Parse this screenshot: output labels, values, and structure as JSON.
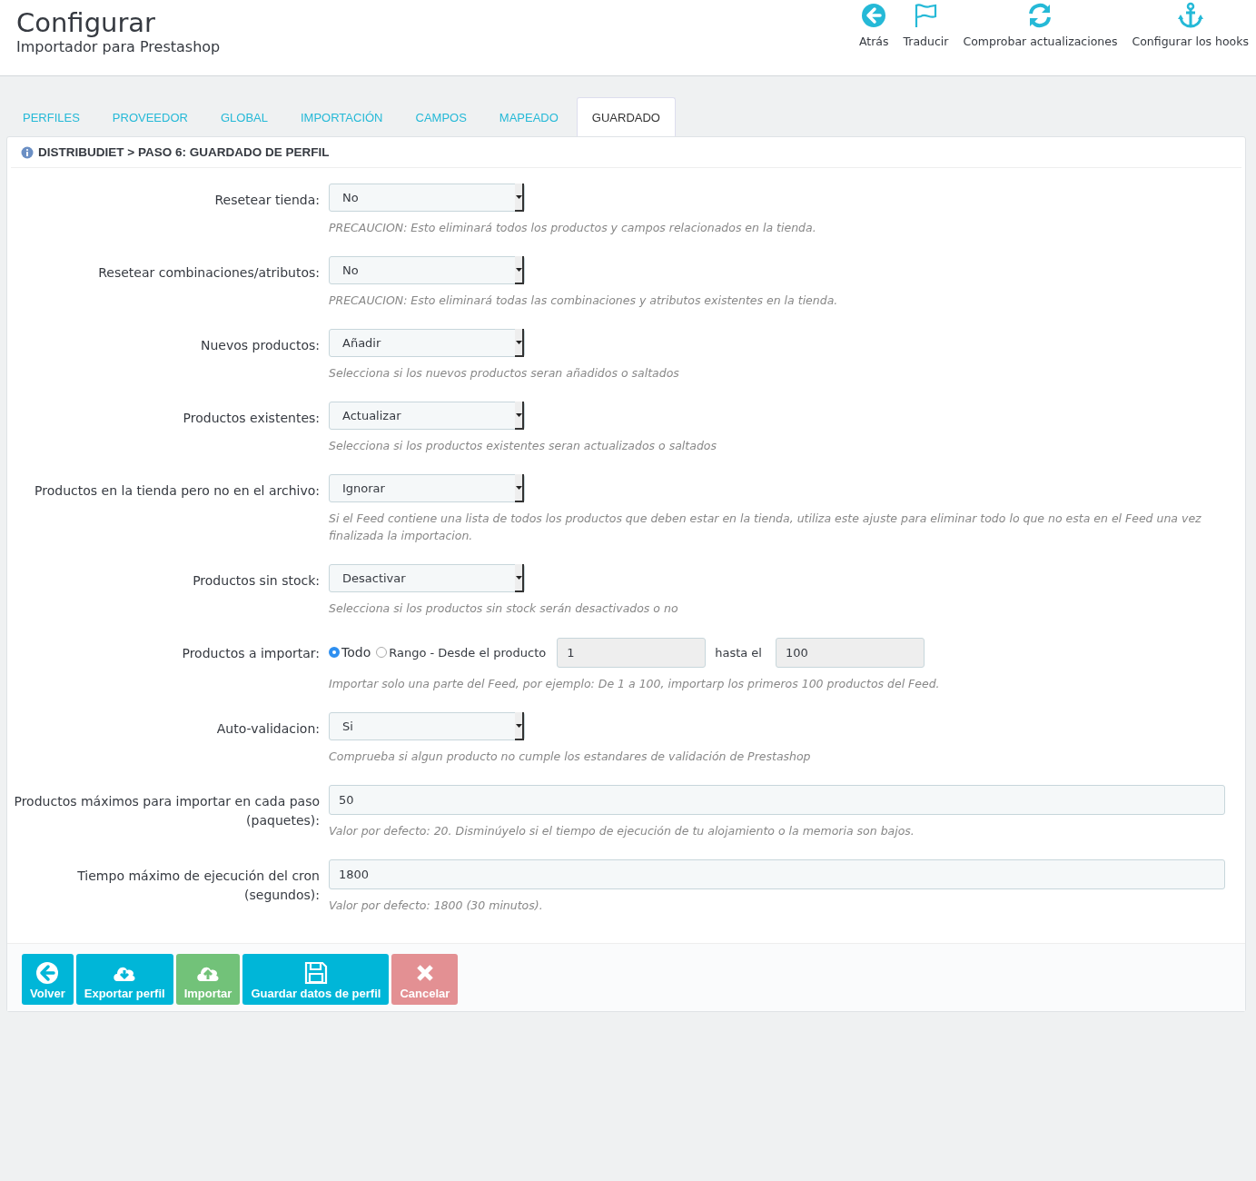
{
  "header": {
    "title": "Configurar",
    "subtitle": "Importador para Prestashop"
  },
  "toolbar": [
    {
      "kind": "back",
      "label": "Atrás"
    },
    {
      "kind": "flag",
      "label": "Traducir"
    },
    {
      "kind": "refresh",
      "label": "Comprobar actualizaciones"
    },
    {
      "kind": "anchor",
      "label": "Configurar los hooks"
    }
  ],
  "tabs": [
    {
      "label": "PERFILES",
      "selected": false
    },
    {
      "label": "PROVEEDOR",
      "selected": false
    },
    {
      "label": "GLOBAL",
      "selected": false
    },
    {
      "label": "IMPORTACIÓN",
      "selected": false
    },
    {
      "label": "CAMPOS",
      "selected": false
    },
    {
      "label": "MAPEADO",
      "selected": false
    },
    {
      "label": "GUARDADO",
      "selected": true
    }
  ],
  "panel": {
    "heading": "DISTRIBUDIET > PASO 6: GUARDADO DE PERFIL",
    "fields": [
      {
        "kind": "select",
        "label": "Resetear tienda:",
        "value": "No",
        "help": "PRECAUCION: Esto eliminará todos los productos y campos relacionados en la tienda."
      },
      {
        "kind": "select",
        "label": "Resetear combinaciones/atributos:",
        "value": "No",
        "help": "PRECAUCION: Esto eliminará todas las combinaciones y atributos existentes en la tienda."
      },
      {
        "kind": "select",
        "label": "Nuevos productos:",
        "value": "Añadir",
        "help": "Selecciona si los nuevos productos seran añadidos o saltados"
      },
      {
        "kind": "select",
        "label": "Productos existentes:",
        "value": "Actualizar",
        "help": "Selecciona si los productos existentes seran actualizados o saltados"
      },
      {
        "kind": "select",
        "label": "Productos en la tienda pero no en el archivo:",
        "value": "Ignorar",
        "help": "Si el Feed contiene una lista de todos los productos que deben estar en la tienda, utiliza este ajuste para eliminar todo lo que no esta en el Feed una vez finalizada la importacion."
      },
      {
        "kind": "select",
        "label": "Productos sin stock:",
        "value": "Desactivar",
        "help": "Selecciona si los productos sin stock serán desactivados o no"
      },
      {
        "kind": "range",
        "label": "Productos a importar:",
        "options": [
          {
            "label": "Todo",
            "selected": true
          },
          {
            "label": "Rango - Desde el producto",
            "selected": false
          }
        ],
        "from": "1",
        "to_label": "hasta el",
        "to": "100",
        "help": "Importar solo una parte del Feed, por ejemplo: De 1 a 100, importarp los primeros 100 productos del Feed."
      },
      {
        "kind": "select",
        "label": "Auto-validacion:",
        "value": "Si",
        "help": "Comprueba si algun producto no cumple los estandares de validación de Prestashop"
      },
      {
        "kind": "text",
        "label": "Productos máximos para importar en cada paso (paquetes):",
        "value": "50",
        "help": "Valor por defecto: 20. Disminúyelo si el tiempo de ejecución de tu alojamiento o la memoria son bajos."
      },
      {
        "kind": "text",
        "label": "Tiempo máximo de ejecución del cron (segundos):",
        "value": "1800",
        "help": "Valor por defecto: 1800 (30 minutos)."
      }
    ]
  },
  "buttons": [
    {
      "kind": "back",
      "label": "Volver"
    },
    {
      "kind": "export",
      "label": "Exportar perfil"
    },
    {
      "kind": "import",
      "label": "Importar"
    },
    {
      "kind": "save",
      "label": "Guardar datos de perfil"
    },
    {
      "kind": "cancel",
      "label": "Cancelar"
    }
  ]
}
